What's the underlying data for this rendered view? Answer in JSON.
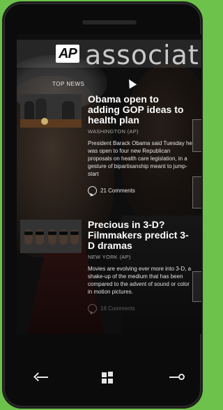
{
  "app": {
    "brand_short": "AP",
    "brand_word": "associat"
  },
  "section": {
    "label": "TOP NEWS"
  },
  "articles": [
    {
      "headline": "Obama open to adding GOP ideas to health plan",
      "dateline": "WASHINGTON (AP)",
      "summary": "President Barack Obama said Tuesday he was open to four new Republican proposals on health care legislation, in a gesture of bipartisanship meant to jump-start",
      "comments": "21 Comments"
    },
    {
      "headline": "Precious in 3-D? Filmmakers predict 3-D dramas",
      "dateline": "NEW YORK (AP)",
      "summary": "Movies are evolving ever more into 3-D, a shake-up of the medium that has been compared to the advent of sound or color in motion pictures.",
      "comments": "16 Comments"
    }
  ],
  "nav": {
    "icons": [
      "back-icon",
      "windows-icon",
      "search-icon"
    ]
  },
  "colors": {
    "background": "#6cc24a",
    "phone": "#0b0b0b",
    "text": "#ffffff"
  }
}
